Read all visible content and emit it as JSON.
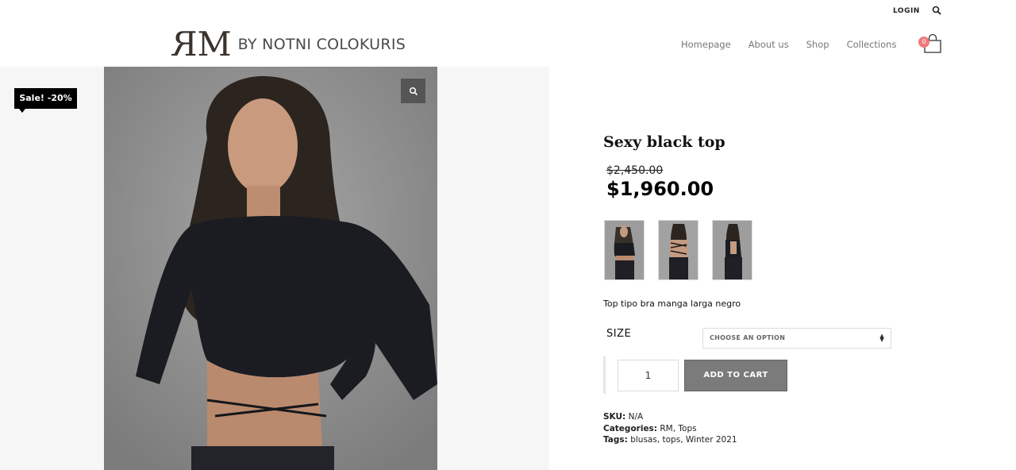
{
  "header": {
    "login_label": "LOGIN",
    "logo_mark": "RM",
    "logo_text": "BY NOTNI COLOKURIS",
    "nav": [
      "Homepage",
      "About us",
      "Shop",
      "Collections"
    ],
    "cart_count": "0"
  },
  "gallery": {
    "sale_badge": "Sale! -20%"
  },
  "product": {
    "title": "Sexy black top",
    "old_price": "$2,450.00",
    "price": "$1,960.00",
    "description": "Top tipo bra manga larga negro",
    "size_label": "SIZE",
    "size_select_value": "CHOOSE AN OPTION",
    "quantity": "1",
    "add_to_cart_label": "ADD TO CART",
    "sku_label": "SKU:",
    "sku_value": "N/A",
    "categories_label": "Categories:",
    "categories": [
      "RM",
      "Tops"
    ],
    "tags_label": "Tags:",
    "tags": [
      "blusas",
      "tops",
      "Winter 2021"
    ]
  },
  "colors": {
    "accent_badge": "#f07a7a",
    "button": "#7b7b7b",
    "sale_badge": "#000000"
  }
}
